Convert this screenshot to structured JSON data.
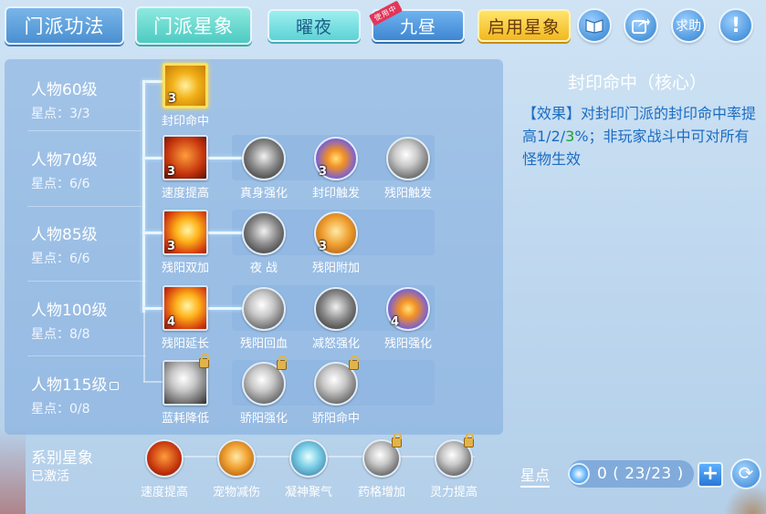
{
  "toolbar": {
    "tab_kungfu": "门派功法",
    "tab_astral": "门派星象",
    "btn_yaoye": "曜夜",
    "btn_jiuzhou": "九昼",
    "btn_jiuzhou_ribbon": "使用中",
    "btn_enable": "启用星象",
    "btn_help": "求助",
    "btn_info": "!"
  },
  "levels": [
    {
      "name": "人物60级",
      "points": "星点：3/3"
    },
    {
      "name": "人物70级",
      "points": "星点：6/6"
    },
    {
      "name": "人物85级",
      "points": "星点：6/6"
    },
    {
      "name": "人物100级",
      "points": "星点：8/8"
    },
    {
      "name": "人物115级",
      "points": "星点：0/8"
    }
  ],
  "rows": [
    {
      "nodes": [
        {
          "label": "封印命中",
          "badge": "3"
        }
      ]
    },
    {
      "nodes": [
        {
          "label": "速度提高",
          "badge": "3"
        },
        {
          "label": "真身强化",
          "badge": ""
        },
        {
          "label": "封印触发",
          "badge": "3"
        },
        {
          "label": "残阳触发",
          "badge": ""
        }
      ]
    },
    {
      "nodes": [
        {
          "label": "残阳双加",
          "badge": "3"
        },
        {
          "label": "夜 战",
          "badge": ""
        },
        {
          "label": "残阳附加",
          "badge": "3"
        }
      ]
    },
    {
      "nodes": [
        {
          "label": "残阳延长",
          "badge": "4"
        },
        {
          "label": "残阳回血",
          "badge": ""
        },
        {
          "label": "减怒强化",
          "badge": ""
        },
        {
          "label": "残阳强化",
          "badge": "4"
        }
      ]
    },
    {
      "nodes": [
        {
          "label": "蓝耗降低",
          "badge": ""
        },
        {
          "label": "骄阳强化",
          "badge": ""
        },
        {
          "label": "骄阳命中",
          "badge": ""
        }
      ]
    }
  ],
  "system": {
    "title": "系别星象",
    "status": "已激活",
    "nodes": [
      "速度提高",
      "宠物减伤",
      "凝神聚气",
      "药格增加",
      "灵力提高"
    ]
  },
  "detail": {
    "title": "封印命中（核心）",
    "text_before": "【效果】对封印门派的封印命中率提高1/2/",
    "text_highlight": "3",
    "text_after": "%；非玩家战斗中可对所有怪物生效"
  },
  "star_points": {
    "label": "星点",
    "value": "0 ( 23/23 )"
  },
  "colors": {
    "accent_gold": "#ffe15a",
    "detail_text": "#1a6cc2",
    "highlight_green": "#1aa22a"
  }
}
